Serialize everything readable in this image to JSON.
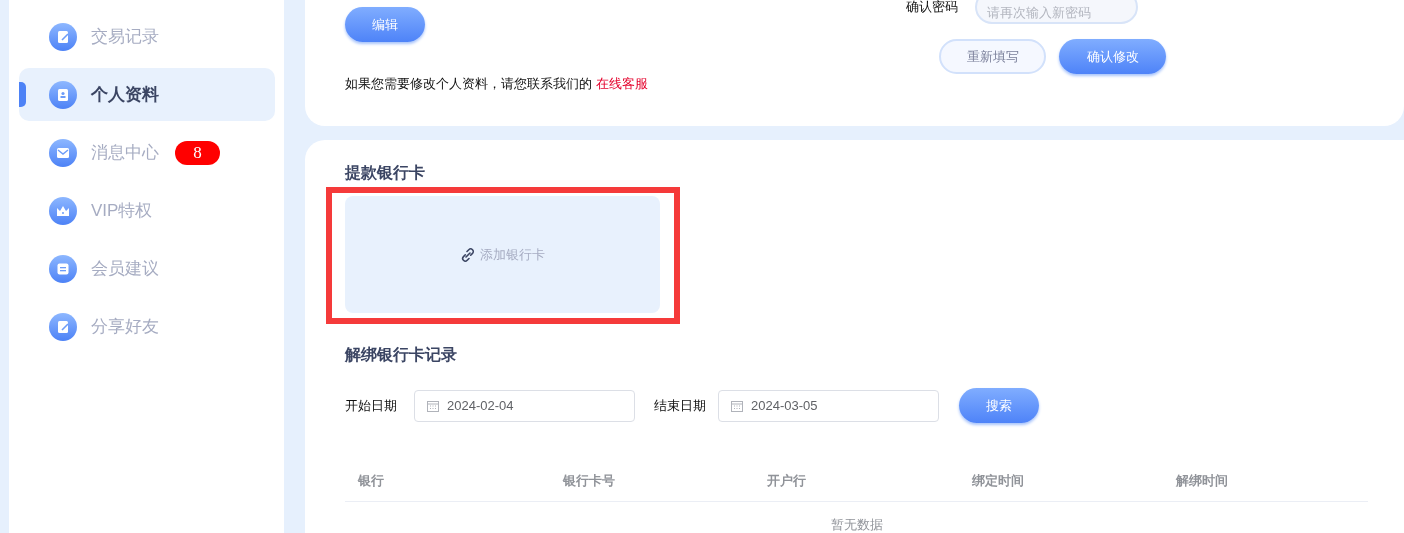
{
  "sidebar": {
    "items": [
      {
        "label": "交易记录",
        "kind": "note",
        "selected": false
      },
      {
        "label": "个人资料",
        "kind": "profile",
        "selected": true
      },
      {
        "label": "消息中心",
        "kind": "mail",
        "selected": false,
        "badge": "8"
      },
      {
        "label": "VIP特权",
        "kind": "crown",
        "selected": false
      },
      {
        "label": "会员建议",
        "kind": "chat",
        "selected": false
      },
      {
        "label": "分享好友",
        "kind": "note",
        "selected": false
      }
    ]
  },
  "profile_card": {
    "edit_button": "编辑",
    "notice": "如果您需要修改个人资料，请您联系我们的",
    "notice_link": "在线客服",
    "confirm_password": {
      "label": "确认密码",
      "placeholder": "请再次输入新密码"
    },
    "reset_button": "重新填写",
    "confirm_button": "确认修改"
  },
  "bank_card": {
    "title": "提款银行卡",
    "add_card": "添加银行卡"
  },
  "unbind_records": {
    "title": "解绑银行卡记录",
    "start_date": {
      "label": "开始日期",
      "value": "2024-02-04"
    },
    "end_date": {
      "label": "结束日期",
      "value": "2024-03-05"
    },
    "search_button": "搜索",
    "table": {
      "columns": [
        "银行",
        "银行卡号",
        "开户行",
        "绑定时间",
        "解绑时间"
      ],
      "empty_text": "暂无数据"
    }
  }
}
